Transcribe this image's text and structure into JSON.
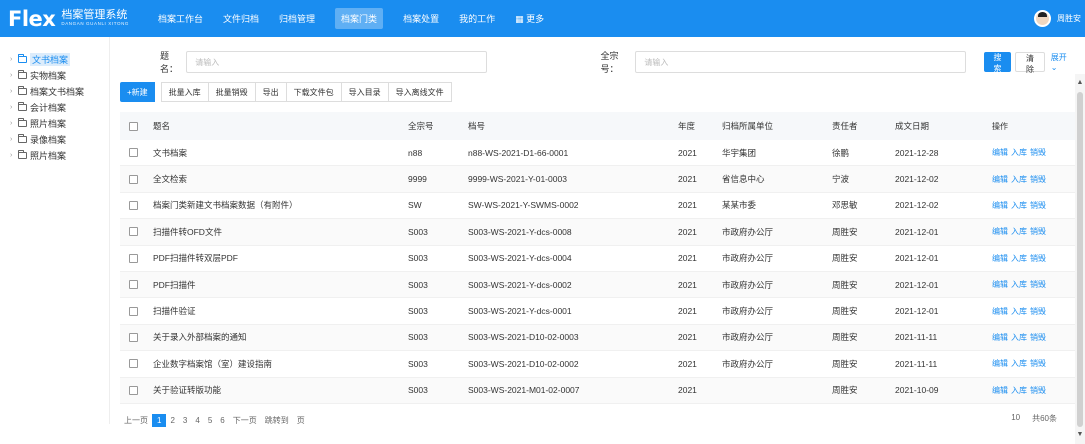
{
  "header": {
    "logo_mark": "Flex",
    "logo_title": "档案管理系统",
    "logo_subtitle": "DANGAN GUANLI XITONG",
    "nav": [
      {
        "label": "档案工作台",
        "active": false
      },
      {
        "label": "文件归档",
        "active": false
      },
      {
        "label": "归档管理",
        "active": false
      },
      {
        "label": "档案门类",
        "active": true
      },
      {
        "label": "档案处置",
        "active": false
      },
      {
        "label": "我的工作",
        "active": false
      },
      {
        "label": "更多",
        "active": false
      }
    ],
    "more_icon": "grid-icon",
    "username": "周胜安"
  },
  "sidebar": {
    "items": [
      {
        "label": "文书档案",
        "active": true
      },
      {
        "label": "实物档案",
        "active": false
      },
      {
        "label": "档案文书档案",
        "active": false
      },
      {
        "label": "会计档案",
        "active": false
      },
      {
        "label": "照片档案",
        "active": false
      },
      {
        "label": "录像档案",
        "active": false
      },
      {
        "label": "照片档案",
        "active": false
      }
    ]
  },
  "search": {
    "title_label": "题名：",
    "title_placeholder": "请输入",
    "fond_label": "全宗号：",
    "fond_placeholder": "请输入",
    "search_button": "搜索",
    "clear_button": "清除",
    "expand_link": "展开"
  },
  "toolbar": {
    "buttons": [
      "+新建",
      "批量入库",
      "批量销毁",
      "导出",
      "下载文件包",
      "导入目录",
      "导入离线文件"
    ]
  },
  "table": {
    "headers": [
      "题名",
      "全宗号",
      "档号",
      "年度",
      "归档所属单位",
      "责任者",
      "成文日期",
      "操作"
    ],
    "ops": [
      "编辑",
      "入库",
      "销毁"
    ],
    "rows": [
      {
        "title": "文书档案",
        "fond": "n88",
        "code": "n88-WS-2021-D1-66-0001",
        "year": "2021",
        "unit": "华宇集团",
        "resp": "徐鹏",
        "date": "2021-12-28"
      },
      {
        "title": "全文检索",
        "fond": "9999",
        "code": "9999-WS-2021-Y-01-0003",
        "year": "2021",
        "unit": "省信息中心",
        "resp": "宁波",
        "date": "2021-12-02"
      },
      {
        "title": "档案门类新建文书档案数据（有附件）",
        "fond": "SW",
        "code": "SW-WS-2021-Y-SWMS-0002",
        "year": "2021",
        "unit": "某某市委",
        "resp": "邓思敏",
        "date": "2021-12-02"
      },
      {
        "title": "扫描件转OFD文件",
        "fond": "S003",
        "code": "S003-WS-2021-Y-dcs-0008",
        "year": "2021",
        "unit": "市政府办公厅",
        "resp": "周胜安",
        "date": "2021-12-01"
      },
      {
        "title": "PDF扫描件转双层PDF",
        "fond": "S003",
        "code": "S003-WS-2021-Y-dcs-0004",
        "year": "2021",
        "unit": "市政府办公厅",
        "resp": "周胜安",
        "date": "2021-12-01"
      },
      {
        "title": "PDF扫描件",
        "fond": "S003",
        "code": "S003-WS-2021-Y-dcs-0002",
        "year": "2021",
        "unit": "市政府办公厅",
        "resp": "周胜安",
        "date": "2021-12-01"
      },
      {
        "title": "扫描件验证",
        "fond": "S003",
        "code": "S003-WS-2021-Y-dcs-0001",
        "year": "2021",
        "unit": "市政府办公厅",
        "resp": "周胜安",
        "date": "2021-12-01"
      },
      {
        "title": "关于录入外部档案的通知",
        "fond": "S003",
        "code": "S003-WS-2021-D10-02-0003",
        "year": "2021",
        "unit": "市政府办公厅",
        "resp": "周胜安",
        "date": "2021-11-11"
      },
      {
        "title": "企业数字档案馆（室）建设指南",
        "fond": "S003",
        "code": "S003-WS-2021-D10-02-0002",
        "year": "2021",
        "unit": "市政府办公厅",
        "resp": "周胜安",
        "date": "2021-11-11"
      },
      {
        "title": "关于验证转版功能",
        "fond": "S003",
        "code": "S003-WS-2021-M01-02-0007",
        "year": "2021",
        "unit": "",
        "resp": "周胜安",
        "date": "2021-10-09"
      }
    ]
  },
  "pager": {
    "items": [
      "上一页",
      "1",
      "2",
      "3",
      "4",
      "5",
      "6",
      "下一页",
      "跳转到",
      "页"
    ],
    "active": "1",
    "page_size": "10",
    "total": "共60条"
  }
}
